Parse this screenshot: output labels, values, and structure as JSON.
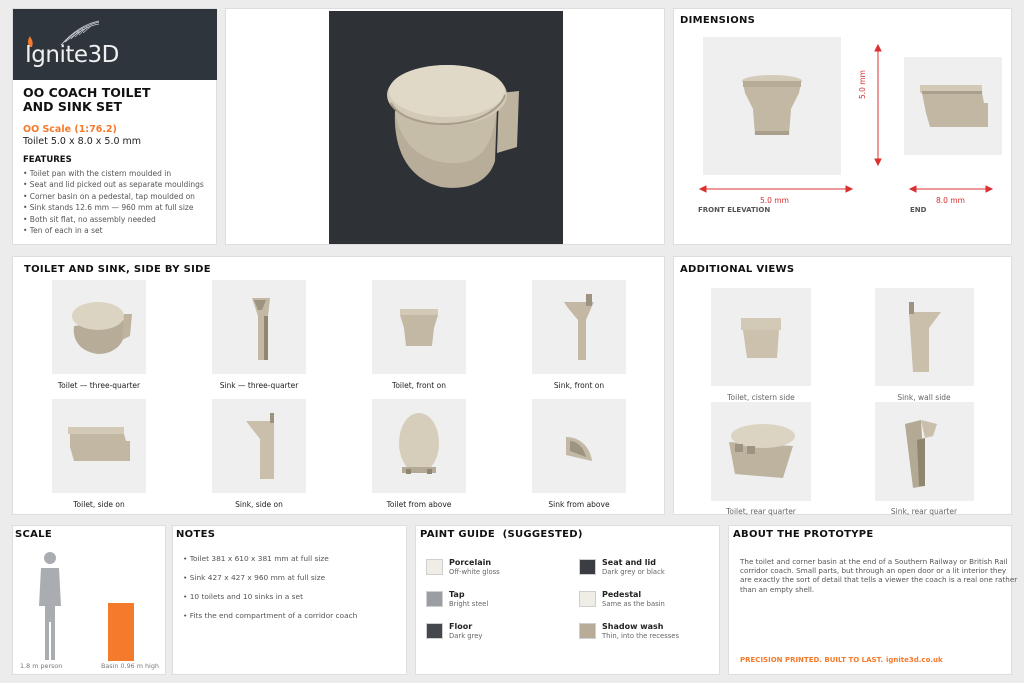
{
  "brand": {
    "name": "Ignite3D",
    "accent": "#f47a2c",
    "dark": "#2e353c"
  },
  "product": {
    "title_line1": "OO COACH TOILET",
    "title_line2": "AND SINK SET",
    "scale": "OO Scale (1:76.2)",
    "size": "Toilet 5.0 x 8.0 x 5.0 mm",
    "features_heading": "FEATURES",
    "features": [
      "• Toilet pan with the cistern moulded in",
      "• Seat and lid picked out as separate mouldings",
      "• Corner basin on a pedestal, tap moulded on",
      "• Sink stands 12.6 mm — 960 mm at full size",
      "• Both sit flat, no assembly needed",
      "• Ten of each in a set"
    ]
  },
  "dimensions": {
    "heading": "DIMENSIONS",
    "width_label": "5.0 mm",
    "height_label": "5.0 mm",
    "depth_label": "8.0 mm",
    "front_label": "FRONT ELEVATION",
    "end_label": "END",
    "arrow_color": "#d93030"
  },
  "side_by_side": {
    "heading": "TOILET AND SINK, SIDE BY SIDE",
    "captions": [
      "Toilet — three-quarter",
      "Sink — three-quarter",
      "Toilet, front on",
      "Sink, front on",
      "Toilet, side on",
      "Sink, side on",
      "Toilet from above",
      "Sink from above"
    ]
  },
  "additional": {
    "heading": "ADDITIONAL VIEWS",
    "captions": [
      "Toilet, cistern side",
      "Sink, wall side",
      "Toilet, rear quarter",
      "Sink, rear quarter"
    ]
  },
  "scale_panel": {
    "heading": "SCALE",
    "person_label": "1.8 m person",
    "basin_label": "Basin 0.96 m high"
  },
  "notes": {
    "heading": "NOTES",
    "items": [
      "• Toilet 381 x 610 x 381 mm at full size",
      "• Sink 427 x 427 x 960 mm at full size",
      "• 10 toilets and 10 sinks in a set",
      "• Fits the end compartment of a corridor coach"
    ]
  },
  "paint": {
    "heading": "PAINT GUIDE  (SUGGESTED)",
    "items": [
      {
        "name": "Porcelain",
        "desc": "Off-white gloss",
        "color": "#f0ede6"
      },
      {
        "name": "Seat and lid",
        "desc": "Dark grey or black",
        "color": "#3a3d42"
      },
      {
        "name": "Tap",
        "desc": "Bright steel",
        "color": "#9a9ea3"
      },
      {
        "name": "Pedestal",
        "desc": "Same as the basin",
        "color": "#f0ede6"
      },
      {
        "name": "Floor",
        "desc": "Dark grey",
        "color": "#44474c"
      },
      {
        "name": "Shadow wash",
        "desc": "Thin, into the recesses",
        "color": "#b8ac98"
      }
    ]
  },
  "about": {
    "heading": "ABOUT THE PROTOTYPE",
    "body": "The toilet and corner basin at the end of a Southern Railway or British Rail corridor coach. Small parts, but through an open door or a lit interior they are exactly the sort of detail that tells a viewer the coach is a real one rather than an empty shell.",
    "tagline": "PRECISION PRINTED. BUILT TO LAST.",
    "url": "ignite3d.co.uk"
  }
}
